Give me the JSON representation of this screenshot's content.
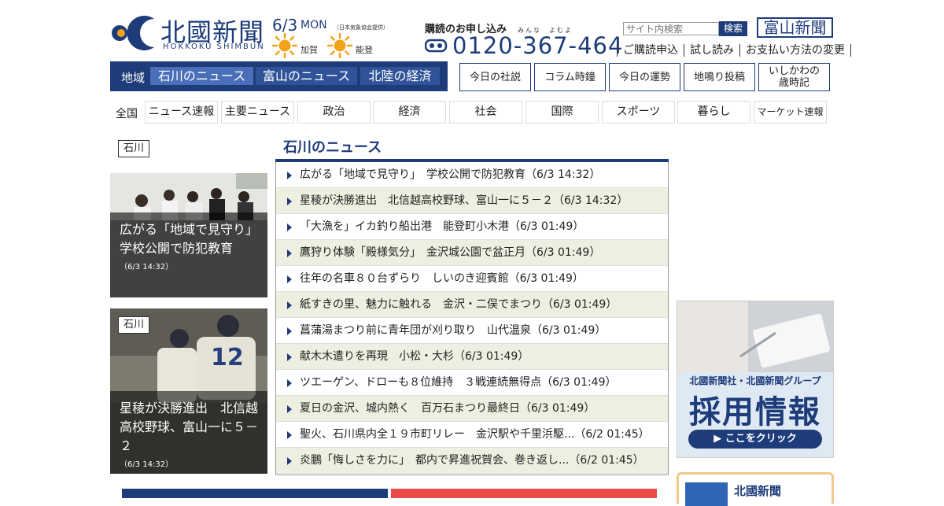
{
  "header": {
    "logo_kanji": "北國新聞",
    "logo_roman": "HOKKOKU SHIMBUN",
    "date": "6/3",
    "day_of_week": "MON",
    "weather_source": "（日本気象協会提供）",
    "weather": [
      {
        "area": "加賀",
        "icon": "sun-icon"
      },
      {
        "area": "能登",
        "icon": "sun-icon"
      }
    ],
    "subscribe_title": "購読のお申し込み",
    "subscribe_ruby": "みんな　よむよ",
    "phone": "0120-367-464",
    "search": {
      "placeholder": "サイト内検索",
      "button": "検索"
    },
    "toyama_logo": "富山新聞",
    "sub_links": [
      "ご購読申込",
      "試し読み",
      "お支払い方法の変更"
    ]
  },
  "region_nav": {
    "label": "地域",
    "tabs": [
      "石川のニュース",
      "富山のニュース",
      "北陸の経済"
    ],
    "buttons": [
      "今日の社説",
      "コラム時鐘",
      "今日の運勢",
      "地鳴り投稿",
      "いしかわの\n歳時記"
    ]
  },
  "genre_nav": {
    "all": "全国",
    "tabs": [
      "ニュース速報",
      "主要ニュース",
      "政治",
      "経済",
      "社会",
      "国際",
      "スポーツ",
      "暮らし",
      "マーケット速報"
    ]
  },
  "left": {
    "section_tag": "石川",
    "photos": [
      {
        "title": "広がる「地域で見守り」　学校公開で防犯教育",
        "date": "（6/3 14:32）"
      },
      {
        "tag": "石川",
        "title": "星稜が決勝進出　北信越高校野球、富山一に５－２",
        "date": "（6/3 14:32）"
      }
    ]
  },
  "news": {
    "title": "石川のニュース",
    "items": [
      "広がる「地域で見守り」　学校公開で防犯教育（6/3 14:32）",
      "星稜が決勝進出　北信越高校野球、富山一に５－２（6/3 14:32）",
      "「大漁を」イカ釣り船出港　能登町小木港（6/3 01:49）",
      "鷹狩り体験「殿様気分」　金沢城公園で盆正月（6/3 01:49）",
      "往年の名車８０台ずらり　しいのき迎賓館（6/3 01:49）",
      "紙すきの里、魅力に触れる　金沢・二俣でまつり（6/3 01:49）",
      "菖蒲湯まつり前に青年団が刈り取り　山代温泉（6/3 01:49）",
      "献木木遣りを再現　小松・大杉（6/3 01:49）",
      "ツエーゲン、ドローも８位維持　３戦連続無得点（6/3 01:49）",
      "夏日の金沢、城内熱く　百万石まつり最終日（6/3 01:49）",
      "聖火、石川県内全１９市町リレー　金沢駅や千里浜駆...（6/2 01:45）",
      "炎鵬「悔しさを力に」　都内で昇進祝賀会、巻き返し...（6/2 01:45）"
    ]
  },
  "right": {
    "recruit_sub": "北國新聞社・北國新聞グループ",
    "recruit_main": "採用情報",
    "recruit_btn": "▶ ここをクリック",
    "promo_text": "北國新聞"
  },
  "colors": {
    "brand": "#1e3c7a",
    "stripe": "#efefe1",
    "accent_sun": "#f2a31b"
  }
}
